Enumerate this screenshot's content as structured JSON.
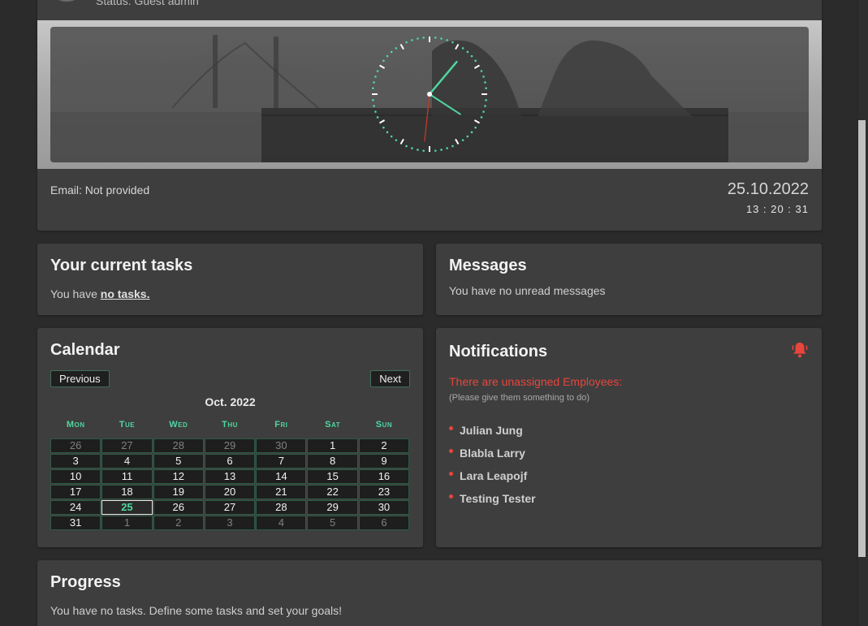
{
  "profile": {
    "status_text": "Status: Guest admin",
    "email_text": "Email: Not provided",
    "date": "25.10.2022",
    "time": "13 : 20 : 31",
    "clock": {
      "hours": 13,
      "minutes": 20,
      "seconds": 31
    }
  },
  "tasks": {
    "title": "Your current tasks",
    "text_prefix": "You have ",
    "text_link": "no tasks."
  },
  "messages": {
    "title": "Messages",
    "text": "You have no unread messages"
  },
  "calendar": {
    "title": "Calendar",
    "prev_label": "Previous",
    "next_label": "Next",
    "month_label": "Oct. 2022",
    "weekdays": [
      "Mon",
      "Tue",
      "Wed",
      "Thu",
      "Fri",
      "Sat",
      "Sun"
    ],
    "weeks": [
      [
        {
          "d": "26",
          "m": true
        },
        {
          "d": "27",
          "m": true
        },
        {
          "d": "28",
          "m": true
        },
        {
          "d": "29",
          "m": true
        },
        {
          "d": "30",
          "m": true
        },
        {
          "d": "1"
        },
        {
          "d": "2"
        }
      ],
      [
        {
          "d": "3"
        },
        {
          "d": "4"
        },
        {
          "d": "5"
        },
        {
          "d": "6"
        },
        {
          "d": "7"
        },
        {
          "d": "8"
        },
        {
          "d": "9"
        }
      ],
      [
        {
          "d": "10"
        },
        {
          "d": "11"
        },
        {
          "d": "12"
        },
        {
          "d": "13"
        },
        {
          "d": "14"
        },
        {
          "d": "15"
        },
        {
          "d": "16"
        }
      ],
      [
        {
          "d": "17"
        },
        {
          "d": "18"
        },
        {
          "d": "19"
        },
        {
          "d": "20"
        },
        {
          "d": "21"
        },
        {
          "d": "22"
        },
        {
          "d": "23"
        }
      ],
      [
        {
          "d": "24"
        },
        {
          "d": "25",
          "today": true
        },
        {
          "d": "26"
        },
        {
          "d": "27"
        },
        {
          "d": "28"
        },
        {
          "d": "29"
        },
        {
          "d": "30"
        }
      ],
      [
        {
          "d": "31"
        },
        {
          "d": "1",
          "m": true
        },
        {
          "d": "2",
          "m": true
        },
        {
          "d": "3",
          "m": true
        },
        {
          "d": "4",
          "m": true
        },
        {
          "d": "5",
          "m": true
        },
        {
          "d": "6",
          "m": true
        }
      ]
    ]
  },
  "notifications": {
    "title": "Notifications",
    "icon": "bell-icon",
    "warning": "There are unassigned Employees:",
    "hint": "(Please give them something to do)",
    "employees": [
      "Julian Jung",
      "Blabla Larry",
      "Lara Leapojf",
      "Testing Tester"
    ]
  },
  "progress": {
    "title": "Progress",
    "text": "You have no tasks. Define some tasks and set your goals!"
  },
  "colors": {
    "accent": "#4fd6a0",
    "alert": "#e8453c",
    "card_bg": "#3e3e3e",
    "page_bg": "#2b2b2b"
  }
}
